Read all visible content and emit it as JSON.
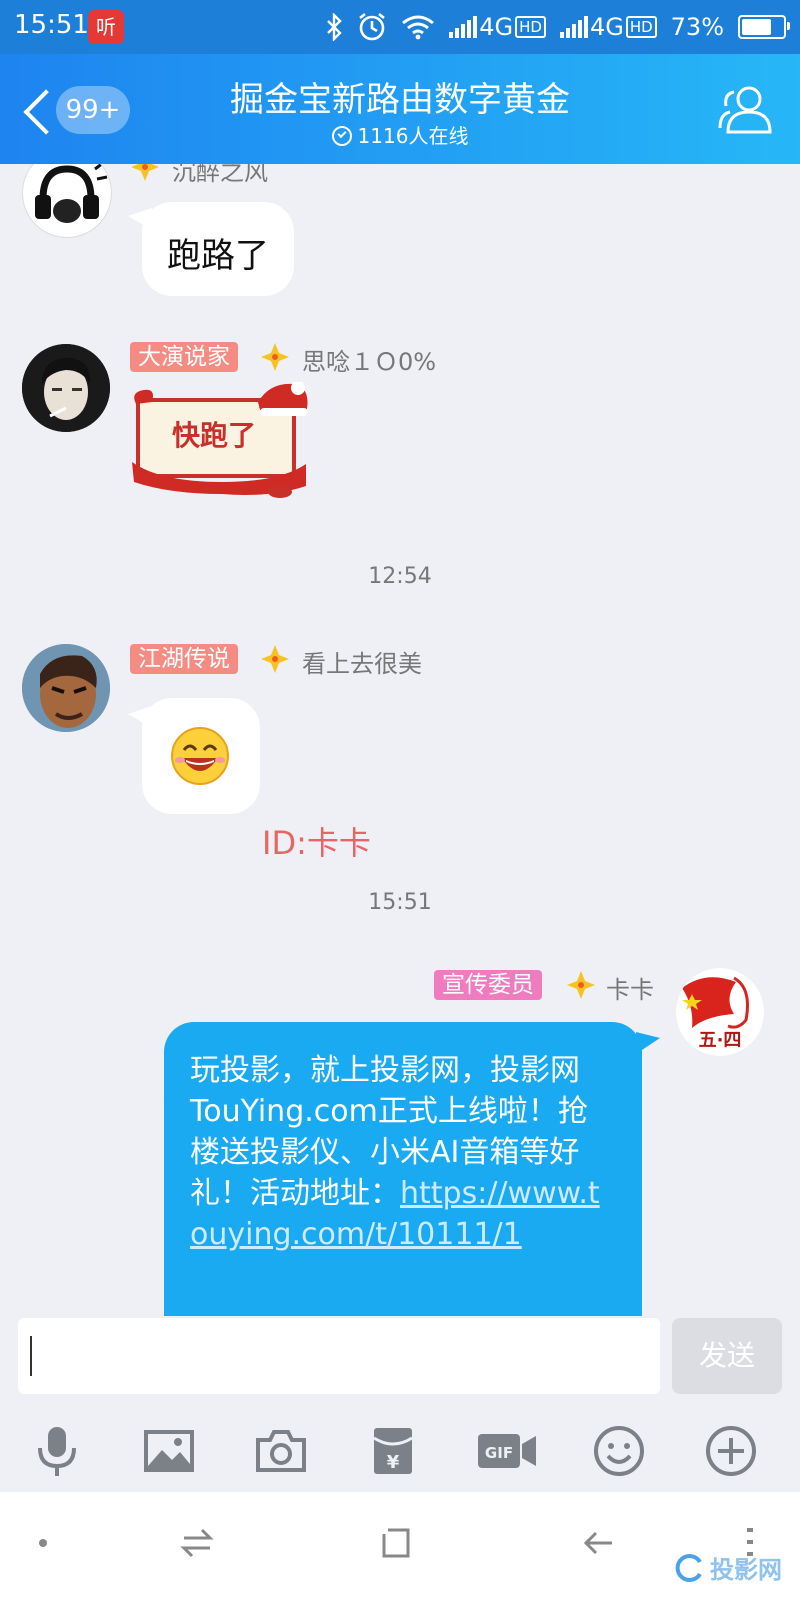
{
  "status_bar": {
    "time": "15:51",
    "notif_char": "听",
    "net1": "4G",
    "hd1": "HD",
    "net2": "4G",
    "hd2": "HD",
    "battery": "73%",
    "battery_level": 0.73
  },
  "header": {
    "back_badge": "99+",
    "title": "掘金宝新路由数字黄金",
    "online": "1116人在线"
  },
  "messages": [
    {
      "nick": "沉醉之风",
      "text": "跑路了"
    },
    {
      "tag": "大演说家",
      "nick": "思唸１Ｏ0%",
      "sticker_text": "快跑了"
    },
    {
      "time": "12:54"
    },
    {
      "tag": "江湖传说",
      "nick": "看上去很美"
    },
    {
      "watermark": "ID:卡卡"
    },
    {
      "time": "15:51"
    },
    {
      "tag": "宣传委员",
      "nick": "卡卡",
      "avatar_text": "五·四",
      "text": "玩投影，就上投影网，投影网TouYing.com正式上线啦！抢楼送投影仪、小米AI音箱等好礼！活动地址：",
      "link": "https://www.touying.com/t/10111/1"
    }
  ],
  "input": {
    "send_label": "发送"
  },
  "toolbar": [
    "mic-icon",
    "image-icon",
    "camera-icon",
    "red-packet-icon",
    "gif-icon",
    "emoji-icon",
    "plus-icon"
  ],
  "corner_watermark": "投影网",
  "colors": {
    "header_start": "#1e84f0",
    "header_end": "#26b7f7",
    "bubble_self": "#1aaaf2",
    "tag_red": "#f48c83",
    "tag_pink": "#f07cc0"
  }
}
